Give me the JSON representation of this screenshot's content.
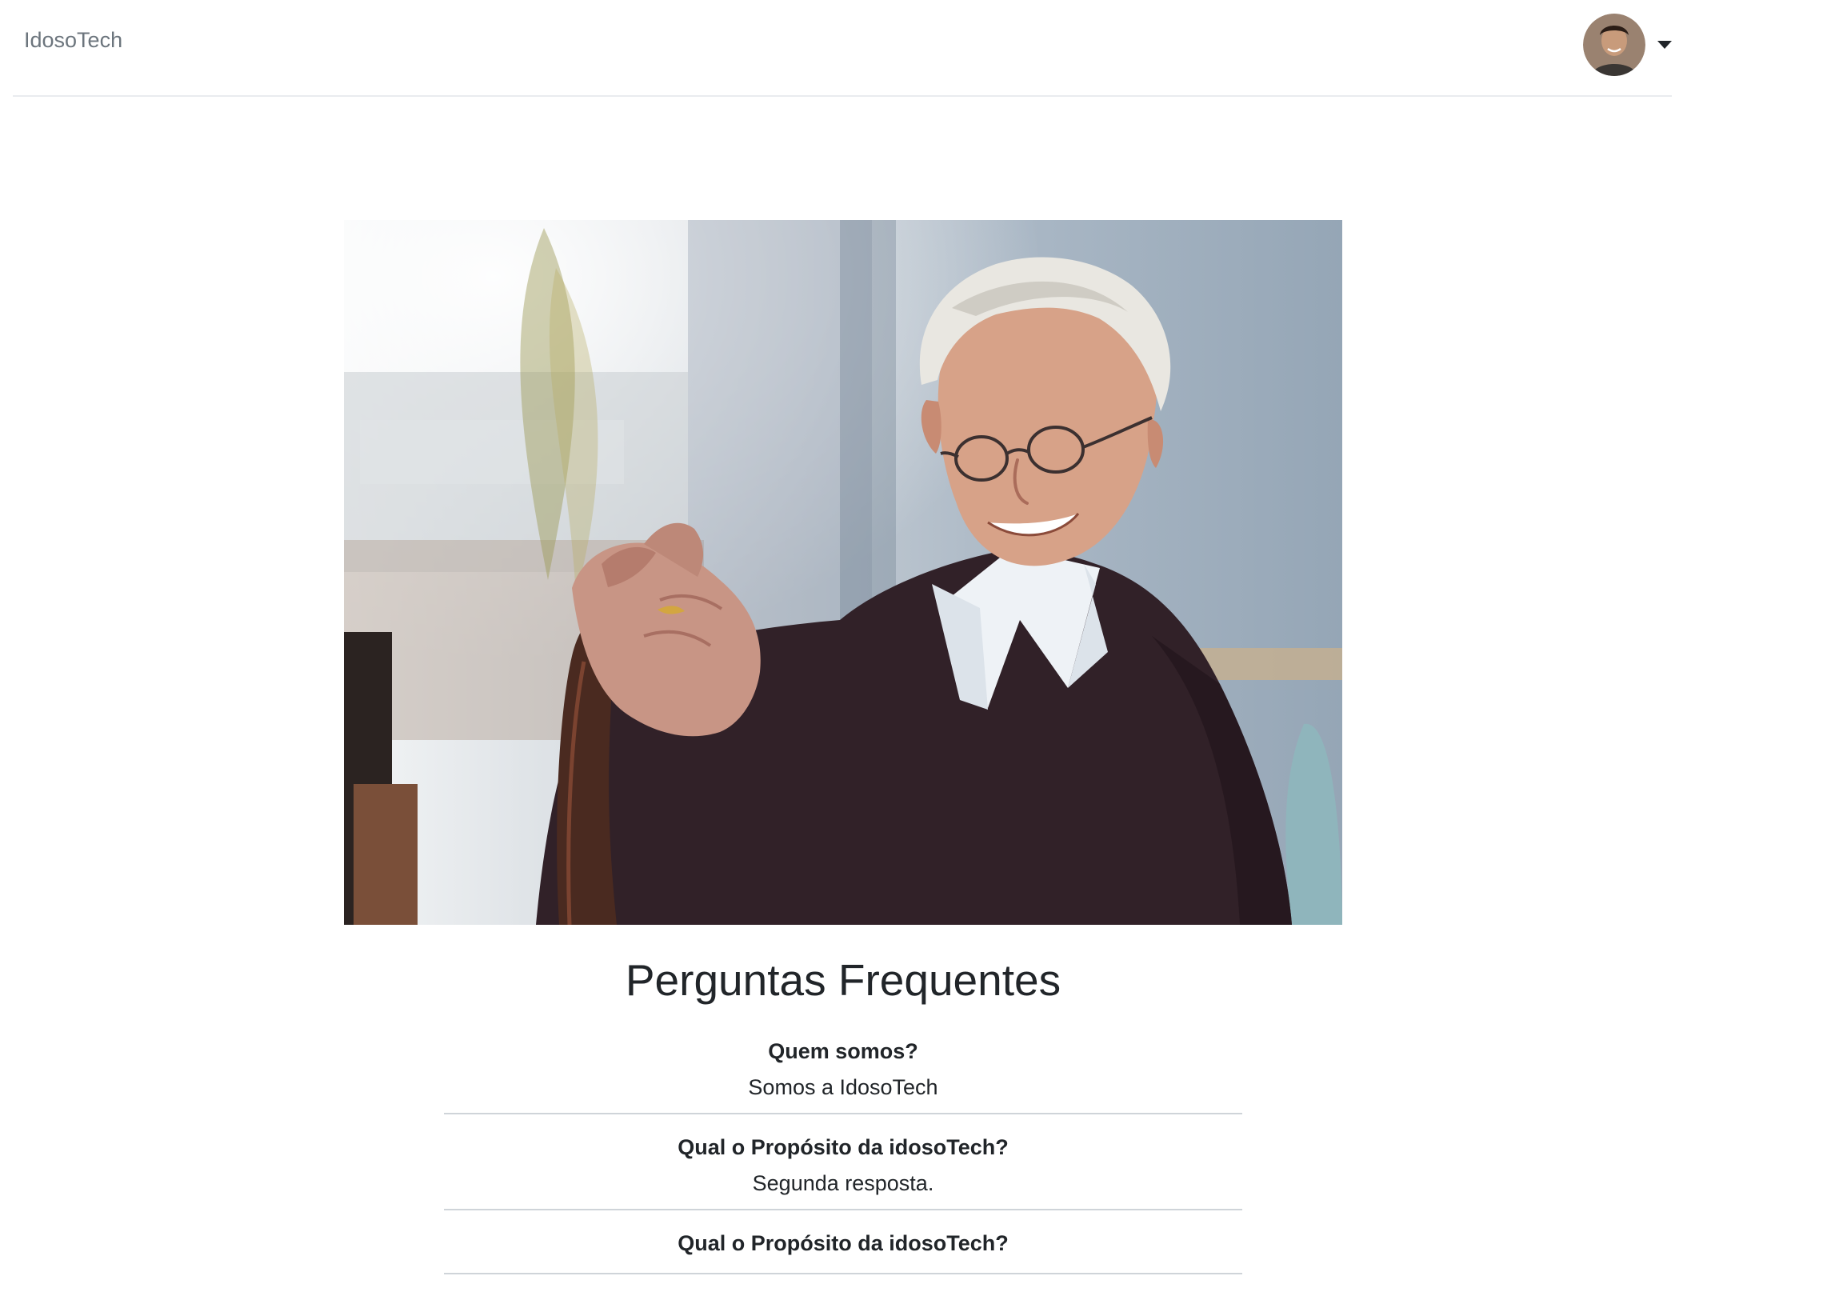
{
  "navbar": {
    "brand": "IdosoTech",
    "user_avatar_alt": "User profile photo"
  },
  "hero": {
    "alt": "Smiling elderly man holding a walking cane"
  },
  "faq": {
    "title": "Perguntas Frequentes",
    "items": [
      {
        "question": "Quem somos?",
        "answer": "Somos a IdosoTech"
      },
      {
        "question": "Qual o Propósito da idosoTech?",
        "answer": "Segunda resposta."
      },
      {
        "question": "Qual o Propósito da idosoTech?",
        "answer": ""
      }
    ]
  }
}
